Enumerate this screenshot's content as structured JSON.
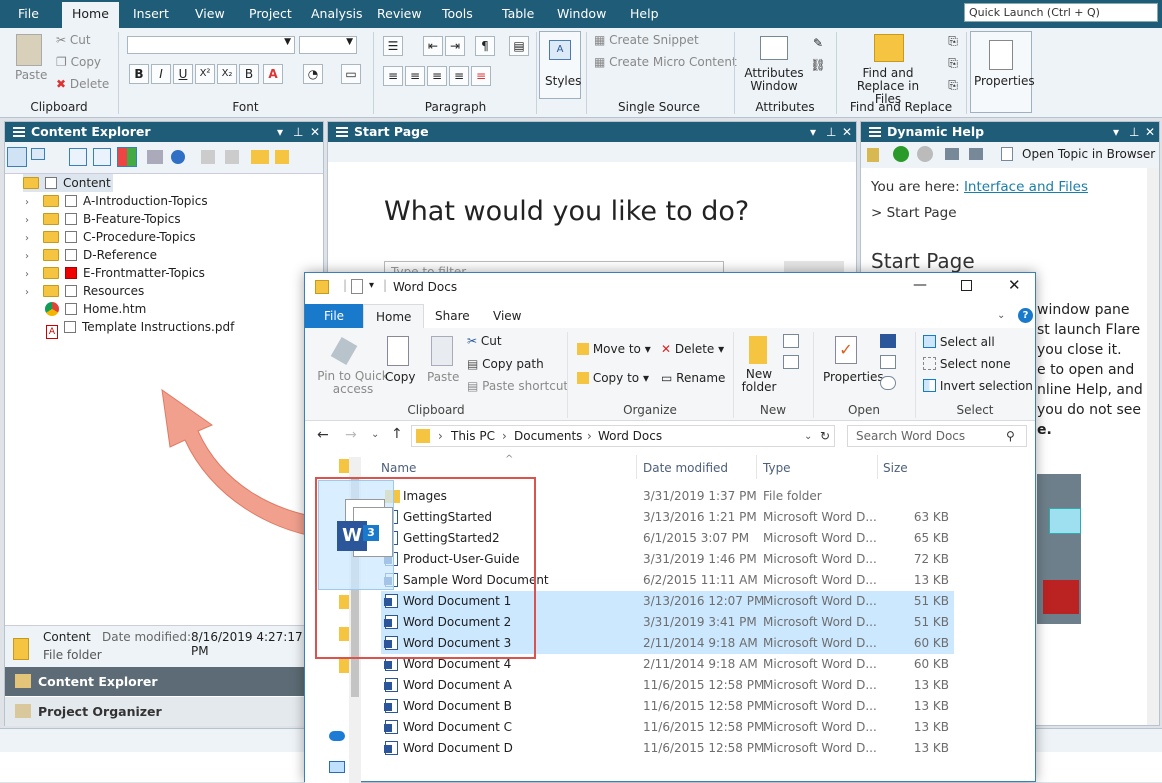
{
  "menubar": {
    "items": [
      "File",
      "Home",
      "Insert",
      "View",
      "Project",
      "Analysis",
      "Review",
      "Tools",
      "Table",
      "Window",
      "Help"
    ],
    "quick_launch_placeholder": "Quick Launch (Ctrl + Q)"
  },
  "ribbon": {
    "clipboard": {
      "paste": "Paste",
      "cut": "Cut",
      "copy": "Copy",
      "delete": "Delete",
      "label": "Clipboard"
    },
    "font": {
      "label": "Font"
    },
    "paragraph": {
      "label": "Paragraph"
    },
    "styles": {
      "label": "Styles"
    },
    "single_source": {
      "create_snippet": "Create Snippet",
      "create_micro": "Create Micro Content",
      "label": "Single Source"
    },
    "attributes": {
      "window": "Attributes Window",
      "label": "Attributes"
    },
    "find": {
      "button": "Find and Replace in Files",
      "label": "Find and Replace"
    },
    "properties": {
      "label": "Properties"
    }
  },
  "content_explorer": {
    "title": "Content Explorer",
    "tree": [
      {
        "label": "Content",
        "type": "root"
      },
      {
        "label": "A-Introduction-Topics",
        "type": "folder"
      },
      {
        "label": "B-Feature-Topics",
        "type": "folder"
      },
      {
        "label": "C-Procedure-Topics",
        "type": "folder"
      },
      {
        "label": "D-Reference",
        "type": "folder"
      },
      {
        "label": "E-Frontmatter-Topics",
        "type": "folder",
        "flag": "red"
      },
      {
        "label": "Resources",
        "type": "folder"
      },
      {
        "label": "Home.htm",
        "type": "htm"
      },
      {
        "label": "Template Instructions.pdf",
        "type": "pdf"
      }
    ],
    "info": {
      "name": "Content",
      "modified_label": "Date modified:",
      "modified": "8/16/2019 4:27:17 PM",
      "type": "File folder"
    },
    "tabs": [
      "Content Explorer",
      "Project Organizer"
    ]
  },
  "start_page": {
    "title": "Start Page",
    "heading": "What would you like to do?",
    "filter_placeholder": "Type to filter"
  },
  "dynamic_help": {
    "title": "Dynamic Help",
    "open_topic": "Open Topic in Browser",
    "you_are_here": "You are here:",
    "link": "Interface and Files",
    "crumb": "> Start Page",
    "heading": "Start Page",
    "body_fragments": [
      "window pane",
      "st launch Flare",
      "you close it.",
      "e to open and",
      "nline Help, and",
      "you do not see",
      "e."
    ]
  },
  "explorer": {
    "title": "Word Docs",
    "tabs": [
      "File",
      "Home",
      "Share",
      "View"
    ],
    "clipboard": {
      "pin": "Pin to Quick access",
      "copy": "Copy",
      "paste": "Paste",
      "cut": "Cut",
      "copy_path": "Copy path",
      "paste_shortcut": "Paste shortcut",
      "label": "Clipboard"
    },
    "organize": {
      "move_to": "Move to",
      "copy_to": "Copy to",
      "delete": "Delete",
      "rename": "Rename",
      "label": "Organize"
    },
    "new": {
      "new_folder": "New folder",
      "label": "New"
    },
    "open": {
      "properties": "Properties",
      "label": "Open"
    },
    "select": {
      "all": "Select all",
      "none": "Select none",
      "invert": "Invert selection",
      "label": "Select"
    },
    "path": [
      "This PC",
      "Documents",
      "Word Docs"
    ],
    "search_placeholder": "Search Word Docs",
    "columns": [
      "Name",
      "Date modified",
      "Type",
      "Size"
    ],
    "files": [
      {
        "name": "Images",
        "date": "3/31/2019 1:37 PM",
        "type": "File folder",
        "size": "",
        "kind": "folder"
      },
      {
        "name": "GettingStarted",
        "date": "3/13/2016 1:21 PM",
        "type": "Microsoft Word D...",
        "size": "63 KB",
        "kind": "word"
      },
      {
        "name": "GettingStarted2",
        "date": "6/1/2015 3:07 PM",
        "type": "Microsoft Word D...",
        "size": "65 KB",
        "kind": "word"
      },
      {
        "name": "Product-User-Guide",
        "date": "3/31/2019 1:46 PM",
        "type": "Microsoft Word D...",
        "size": "72 KB",
        "kind": "word"
      },
      {
        "name": "Sample Word Document",
        "date": "6/2/2015 11:11 AM",
        "type": "Microsoft Word D...",
        "size": "13 KB",
        "kind": "word"
      },
      {
        "name": "Word Document 1",
        "date": "3/13/2016 12:07 PM",
        "type": "Microsoft Word D...",
        "size": "51 KB",
        "kind": "word",
        "selected": true
      },
      {
        "name": "Word Document 2",
        "date": "3/31/2019 3:41 PM",
        "type": "Microsoft Word D...",
        "size": "51 KB",
        "kind": "word",
        "selected": true
      },
      {
        "name": "Word Document 3",
        "date": "2/11/2014 9:18 AM",
        "type": "Microsoft Word D...",
        "size": "60 KB",
        "kind": "word",
        "selected": true
      },
      {
        "name": "Word Document 4",
        "date": "2/11/2014 9:18 AM",
        "type": "Microsoft Word D...",
        "size": "60 KB",
        "kind": "word"
      },
      {
        "name": "Word Document A",
        "date": "11/6/2015 12:58 PM",
        "type": "Microsoft Word D...",
        "size": "13 KB",
        "kind": "word"
      },
      {
        "name": "Word Document B",
        "date": "11/6/2015 12:58 PM",
        "type": "Microsoft Word D...",
        "size": "13 KB",
        "kind": "word"
      },
      {
        "name": "Word Document C",
        "date": "11/6/2015 12:58 PM",
        "type": "Microsoft Word D...",
        "size": "13 KB",
        "kind": "word"
      },
      {
        "name": "Word Document D",
        "date": "11/6/2015 12:58 PM",
        "type": "Microsoft Word D...",
        "size": "13 KB",
        "kind": "word"
      }
    ],
    "drag_badge": "3"
  },
  "colors": {
    "titlebar": "#1f5c78",
    "selection": "#cce8ff",
    "highlight_box": "#d9534f",
    "arrow": "#f2a08e"
  }
}
